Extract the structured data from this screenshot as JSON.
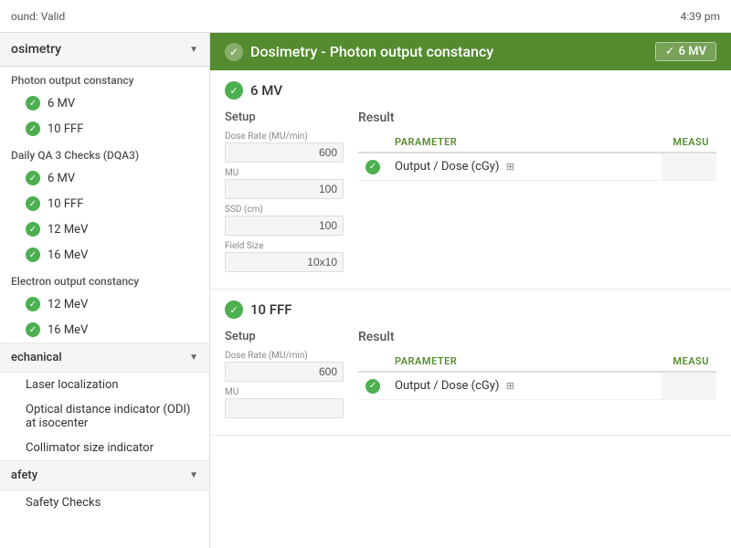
{
  "topbar": {
    "status_label": "ound: Valid",
    "time": "4:39 pm"
  },
  "sidebar": {
    "category_label": "osimetry",
    "sections": [
      {
        "id": "photon_output",
        "title": "Photon output constancy",
        "items": [
          {
            "label": "6 MV",
            "status": "valid"
          },
          {
            "label": "10 FFF",
            "status": "valid"
          }
        ]
      },
      {
        "id": "daily_qa3",
        "title": "Daily QA 3 Checks (DQA3)",
        "items": [
          {
            "label": "6 MV",
            "status": "valid"
          },
          {
            "label": "10 FFF",
            "status": "valid"
          },
          {
            "label": "12 MeV",
            "status": "valid"
          },
          {
            "label": "16 MeV",
            "status": "valid"
          }
        ]
      },
      {
        "id": "electron_output",
        "title": "Electron output constancy",
        "items": [
          {
            "label": "12 MeV",
            "status": "valid"
          },
          {
            "label": "16 MeV",
            "status": "valid"
          }
        ]
      }
    ],
    "groups": [
      {
        "label": "echanical"
      },
      {
        "label": "afety"
      }
    ],
    "group_items": {
      "mechanical": [
        "Laser localization",
        "Optical distance indicator (ODI) at isocenter",
        "Collimator size indicator"
      ]
    }
  },
  "content": {
    "header_title": "Dosimetry - Photon output constancy",
    "badge_label": "6 MV",
    "check_symbol": "✓",
    "beam_sections": [
      {
        "id": "6mv",
        "title": "6 MV",
        "setup": {
          "label": "Setup",
          "fields": [
            {
              "label": "Dose Rate (MU/min)",
              "value": "600"
            },
            {
              "label": "MU",
              "value": "100"
            },
            {
              "label": "SSD (cm)",
              "value": "100"
            },
            {
              "label": "Field Size",
              "value": "10x10"
            }
          ]
        },
        "result": {
          "label": "Result",
          "columns": [
            "PARAMETER",
            "MEASU"
          ],
          "rows": [
            {
              "param": "Output / Dose (cGy)",
              "measure": "",
              "status": "valid"
            }
          ]
        }
      },
      {
        "id": "10fff",
        "title": "10 FFF",
        "setup": {
          "label": "Setup",
          "fields": [
            {
              "label": "Dose Rate (MU/min)",
              "value": "600"
            },
            {
              "label": "MU",
              "value": ""
            }
          ]
        },
        "result": {
          "label": "Result",
          "columns": [
            "PARAMETER",
            "MEASU"
          ],
          "rows": [
            {
              "param": "Output / Dose (cGy)",
              "measure": "",
              "status": "valid"
            }
          ]
        }
      }
    ]
  }
}
